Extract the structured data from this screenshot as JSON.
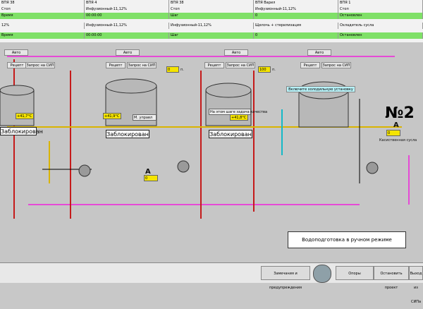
{
  "header": {
    "top_titles": [
      "ВПЯ 38",
      "ВПЯ 4",
      "ВПЯ 38",
      "ВПЯ Варил",
      "ВПЯ 1"
    ],
    "status_row": [
      [
        "Стоп",
        "Инфузионный-11,12%",
        "Стоп"
      ],
      [
        "Время",
        "00:00:00",
        "Шаг",
        "0",
        "Остановлен"
      ]
    ],
    "sections": [
      {
        "title": "12%",
        "state": "Стоп"
      },
      {
        "title": "Инфузионный-11,12%",
        "state": "Стоп"
      },
      {
        "title": "Инфузионный-11,12%",
        "state": "Стоп"
      },
      {
        "title": "Щелочь + стерилизация",
        "state": "Стоп"
      }
    ],
    "right_label": "Охладитель сусла"
  },
  "mimic": {
    "buttons": {
      "auto1": "Авто",
      "recept1": "Рецепт",
      "request1": "Запрос на СИП",
      "auto2": "Авто",
      "recept2": "Рецепт",
      "request2": "Запрос на СИП",
      "auto3": "Авто",
      "recept3": "Рецепт",
      "request3": "Запрос на СИП",
      "auto4": "Авто",
      "recept4": "Рецепт",
      "request4": "Запрос на СИП"
    },
    "tanks": [
      {
        "status": "Заблокирован"
      },
      {
        "status": "Заблокирован",
        "mode": "М. управл"
      },
      {
        "status": "Заблокирован",
        "mode": "На этом шаге задача качества"
      },
      {
        "status": "Заблокирован"
      }
    ],
    "cooling_btn": "Включите холодильную установку",
    "no_label": "№2",
    "water_msg": "Водоподготовка в ручном режиме",
    "small_values": {
      "v1": "0",
      "v2": "100",
      "v3": "0",
      "v4": "0"
    },
    "unit_p": "п.",
    "unit_c": "°С",
    "temp_values": {
      "t1": "+41,7°С",
      "t2": "+41,9°С",
      "t3": "+41,8°С"
    },
    "flow_label": "Касиственная сусла",
    "a_label": "А"
  },
  "footer": {
    "btn1": "Замечания и предупреждения",
    "btn2": "Опоры",
    "btn3": "Остановить проект",
    "btn4": "Выход из СИПа"
  }
}
